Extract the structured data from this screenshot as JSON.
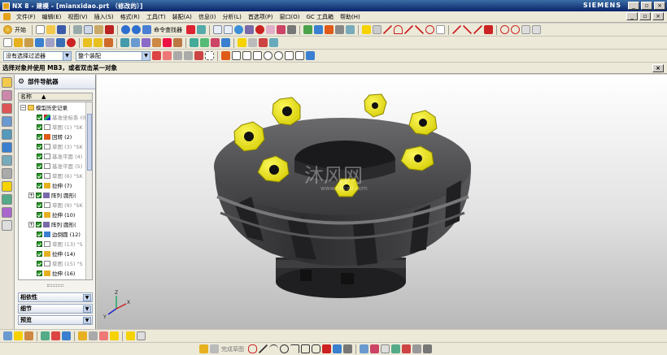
{
  "window": {
    "title": "NX 8 - 建模 - [mianxidao.prt （修改的）]",
    "brand": "SIEMENS",
    "minimize": "_",
    "restore": "▫",
    "close": "×"
  },
  "menu": {
    "items": [
      "文件(F)",
      "编辑(E)",
      "视图(V)",
      "插入(S)",
      "格式(R)",
      "工具(T)",
      "装配(A)",
      "信息(I)",
      "分析(L)",
      "首选项(P)",
      "窗口(O)",
      "GC 工具箱",
      "帮助(H)"
    ],
    "doc_min": "_",
    "doc_restore": "▫",
    "doc_close": "×"
  },
  "toolbar": {
    "start_label": "开始",
    "command_finder_label": "命令查找器"
  },
  "selection_bar": {
    "filter_value": "没有选择过滤器",
    "scope_value": "整个装配"
  },
  "status": {
    "prompt": "选择对象并使用 MB3，或者双击某一对象"
  },
  "navigator": {
    "title": "部件导航器",
    "column_name": "名称",
    "tree": [
      {
        "label": "模型历史记录",
        "type": "folder",
        "expand": "−",
        "checked": false,
        "dim": false
      },
      {
        "label": "基准坐标系 (0)",
        "type": "csys",
        "expand": "",
        "checked": true,
        "dim": true
      },
      {
        "label": "草图 (1) \"SK",
        "type": "sketch",
        "expand": "",
        "checked": true,
        "dim": true
      },
      {
        "label": "回转 (2)",
        "type": "revolve",
        "expand": "",
        "checked": true,
        "dim": false
      },
      {
        "label": "草图 (3) \"SK",
        "type": "sketch",
        "expand": "",
        "checked": true,
        "dim": true
      },
      {
        "label": "基准平面 (4)",
        "type": "plane",
        "expand": "",
        "checked": true,
        "dim": true
      },
      {
        "label": "基准平面 (5)",
        "type": "plane",
        "expand": "",
        "checked": true,
        "dim": true
      },
      {
        "label": "草图 (6) \"SK",
        "type": "sketch",
        "expand": "",
        "checked": true,
        "dim": true
      },
      {
        "label": "拉伸 (7)",
        "type": "extrude",
        "expand": "",
        "checked": true,
        "dim": false
      },
      {
        "label": "阵列 圆形(",
        "type": "pattern",
        "expand": "+",
        "checked": true,
        "dim": false
      },
      {
        "label": "草图 (9) \"SK",
        "type": "sketch",
        "expand": "",
        "checked": true,
        "dim": true
      },
      {
        "label": "拉伸 (10)",
        "type": "extrude",
        "expand": "",
        "checked": true,
        "dim": false
      },
      {
        "label": "阵列 圆形(",
        "type": "pattern",
        "expand": "+",
        "checked": true,
        "dim": false
      },
      {
        "label": "边倒圆 (12)",
        "type": "blend",
        "expand": "",
        "checked": true,
        "dim": false
      },
      {
        "label": "草图 (13) \"S",
        "type": "sketch",
        "expand": "",
        "checked": true,
        "dim": true
      },
      {
        "label": "拉伸 (14)",
        "type": "extrude",
        "expand": "",
        "checked": true,
        "dim": false
      },
      {
        "label": "草图 (15) \"S",
        "type": "sketch",
        "expand": "",
        "checked": true,
        "dim": true
      },
      {
        "label": "拉伸 (16)",
        "type": "extrude",
        "expand": "",
        "checked": true,
        "dim": false
      }
    ],
    "panels": [
      "相依性",
      "细节",
      "预览"
    ]
  },
  "viewport": {
    "watermark_cn": "沐风网",
    "watermark_url": "www.mfcad.com",
    "triad_x": "X",
    "triad_y": "Y",
    "triad_z": "Z"
  },
  "bottom_toolbar": {
    "sketch_label": "完成草图"
  },
  "colors": {
    "titlebar": "#0a246a",
    "insert_yellow": "#f2ee1a",
    "body_dark": "#3a3a3c",
    "check_green": "#2b9b2b"
  }
}
